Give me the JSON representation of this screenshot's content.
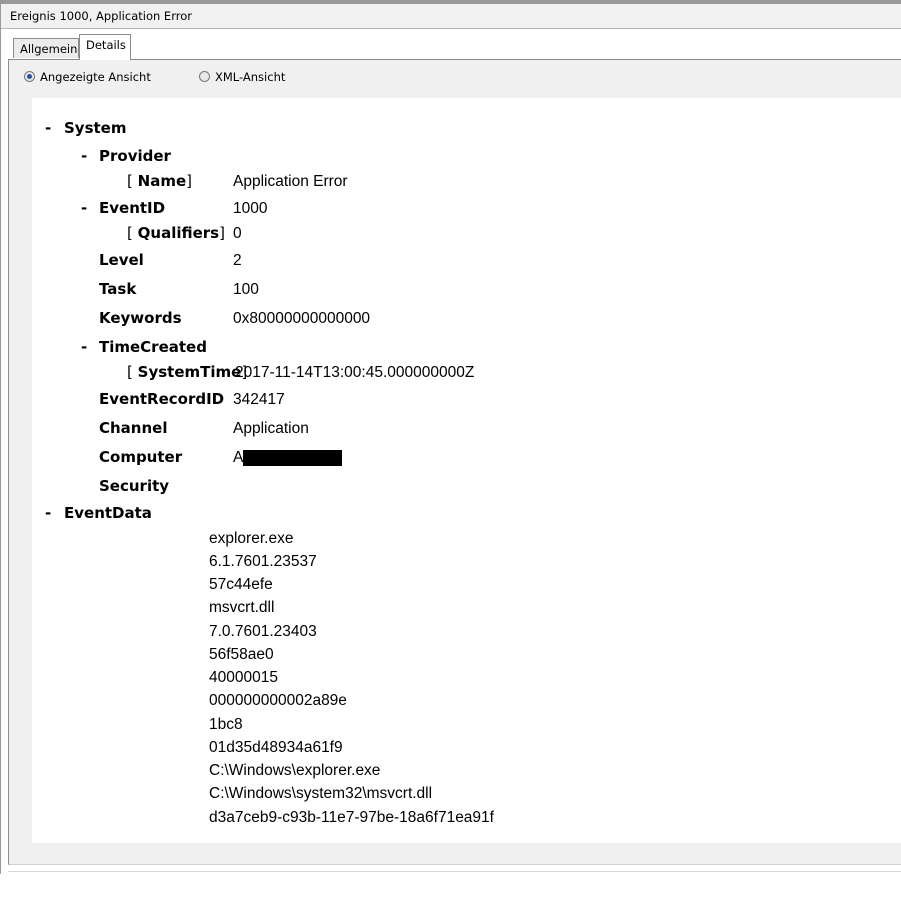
{
  "window": {
    "title": "Ereignis 1000, Application Error"
  },
  "tabs": {
    "general": "Allgemein",
    "details": "Details"
  },
  "view": {
    "friendly": "Angezeigte Ansicht",
    "xml": "XML-Ansicht"
  },
  "tree": {
    "collapse_glyph": "-",
    "open_bracket": "[",
    "close_bracket": "]",
    "system": "System",
    "provider": "Provider",
    "name_key": "Name",
    "name_val": "Application Error",
    "eventid": "EventID",
    "eventid_val": "1000",
    "qualifiers_key": "Qualifiers",
    "qualifiers_val": "0",
    "level": "Level",
    "level_val": "2",
    "task": "Task",
    "task_val": "100",
    "keywords": "Keywords",
    "keywords_val": "0x80000000000000",
    "timecreated": "TimeCreated",
    "systemtime_key": "SystemTime",
    "systemtime_val": "2017-11-14T13:00:45.000000000Z",
    "recordid": "EventRecordID",
    "recordid_val": "342417",
    "channel": "Channel",
    "channel_val": "Application",
    "computer": "Computer",
    "computer_val": "A",
    "security": "Security",
    "eventdata": "EventData",
    "eventdata_values": [
      "explorer.exe",
      "6.1.7601.23537",
      "57c44efe",
      "msvcrt.dll",
      "7.0.7601.23403",
      "56f58ae0",
      "40000015",
      "000000000002a89e",
      "1bc8",
      "01d35d48934a61f9",
      "C:\\Windows\\explorer.exe",
      "C:\\Windows\\system32\\msvcrt.dll",
      "d3a7ceb9-c93b-11e7-97be-18a6f71ea91f"
    ]
  }
}
